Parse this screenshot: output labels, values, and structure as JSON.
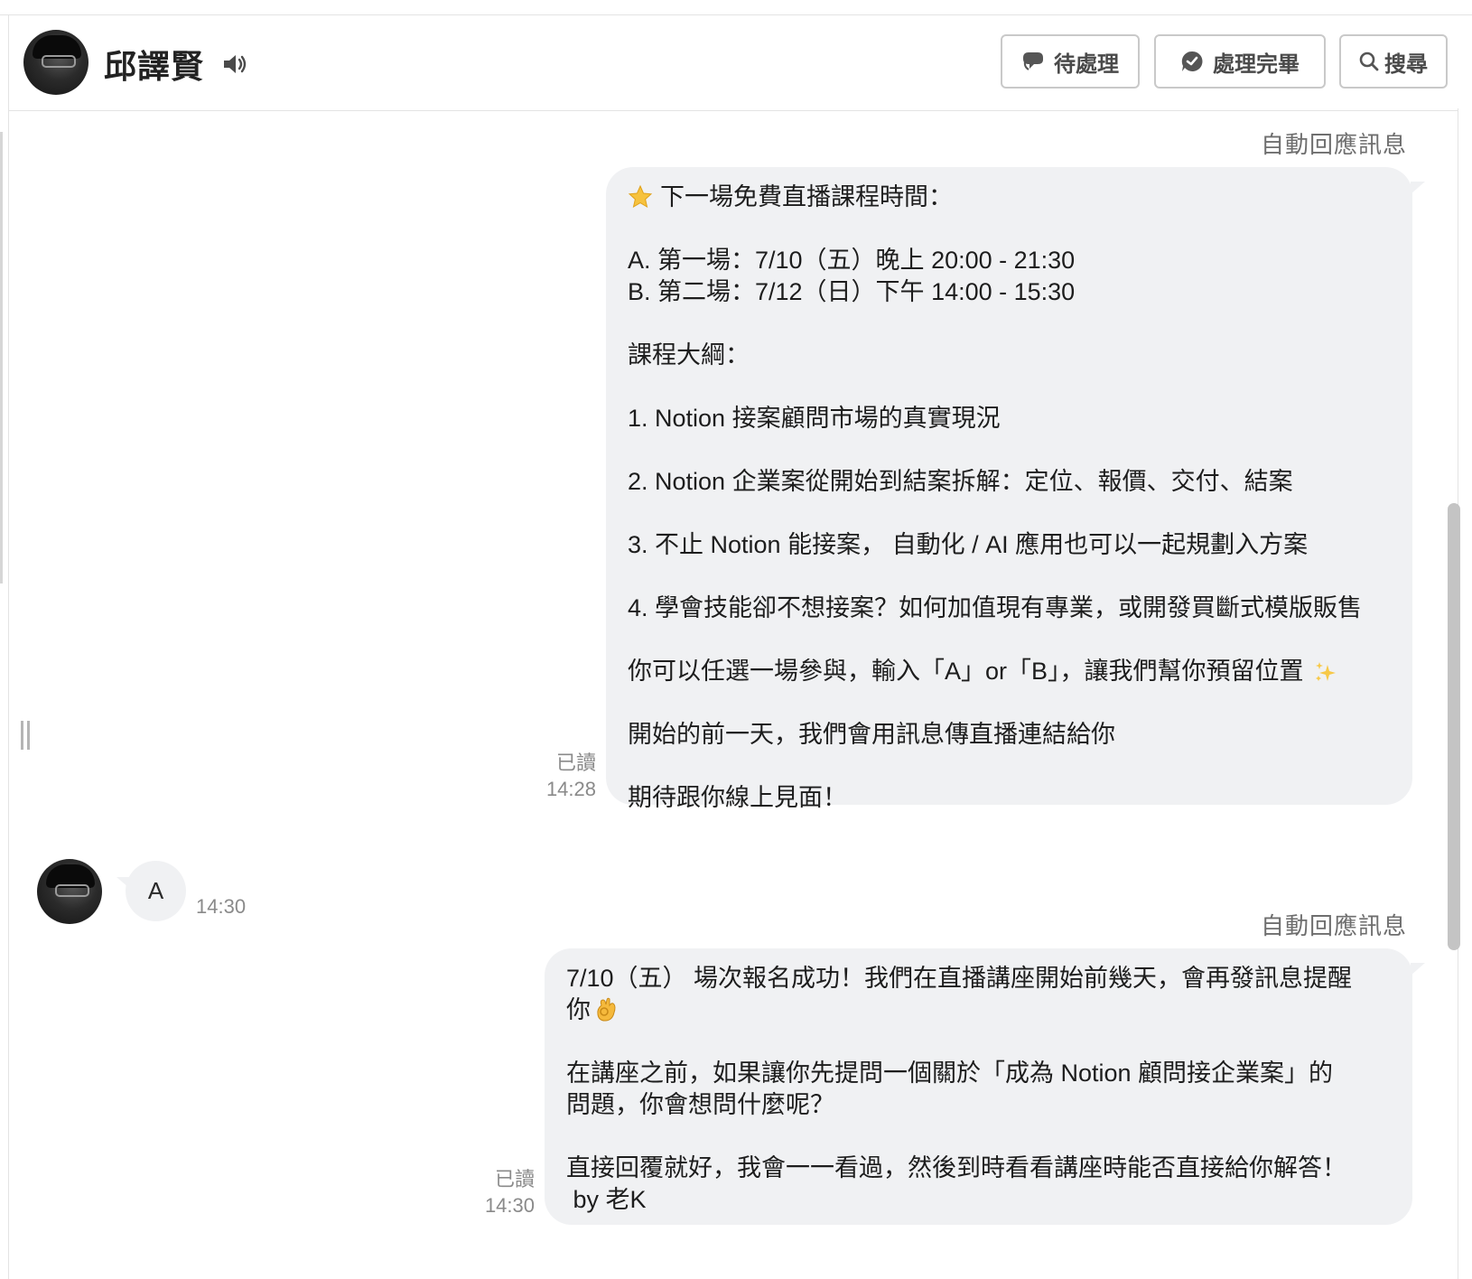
{
  "header": {
    "contact_name": "邱譯賢",
    "buttons": {
      "pending": "待處理",
      "done": "處理完畢",
      "search": "搜尋"
    }
  },
  "messages": [
    {
      "type": "outgoing",
      "label": "自動回應訊息",
      "lines": [
        "下一場免費直播課程時間：",
        "",
        "A. 第一場：7/10（五）晚上 20:00 - 21:30",
        "B. 第二場：7/12（日）下午 14:00 - 15:30",
        "",
        "課程大綱：",
        "",
        "1. Notion 接案顧問市場的真實現況",
        "",
        "2. Notion 企業案從開始到結案拆解：定位、報價、交付、結案",
        "",
        "3. 不止 Notion 能接案， 自動化 / AI 應用也可以一起規劃入方案",
        "",
        "4. 學會技能卻不想接案？如何加值現有專業，或開發買斷式模版販售",
        "",
        "你可以任選一場參與，輸入「A」or「B」，讓我們幫你預留位置",
        "",
        "開始的前一天，我們會用訊息傳直播連結給你",
        "",
        "期待跟你線上見面！"
      ],
      "status": "已讀",
      "time": "14:28"
    },
    {
      "type": "incoming",
      "text": "A",
      "time": "14:30"
    },
    {
      "type": "outgoing",
      "label": "自動回應訊息",
      "lines": [
        "7/10（五） 場次報名成功！我們在直播講座開始前幾天，會再發訊息提醒",
        "你",
        "",
        "在講座之前，如果讓你先提問一個關於「成為 Notion 顧問接企業案」的",
        "問題，你會想問什麼呢？",
        "",
        "直接回覆就好，我會一一看過，然後到時看看講座時能否直接給你解答！",
        " by 老K"
      ],
      "status": "已讀",
      "time": "14:30"
    }
  ],
  "icons": {
    "speaker": "speaker-icon",
    "pending": "chat-bubble-icon",
    "done": "check-bubble-icon",
    "search": "search-icon",
    "star": "star-emoji",
    "sparkle": "sparkles-emoji",
    "ok": "ok-hand-emoji"
  },
  "colors": {
    "bubble": "#f0f1f3",
    "muted_text": "#8a8a8a",
    "button_border": "#c9c9c9"
  }
}
